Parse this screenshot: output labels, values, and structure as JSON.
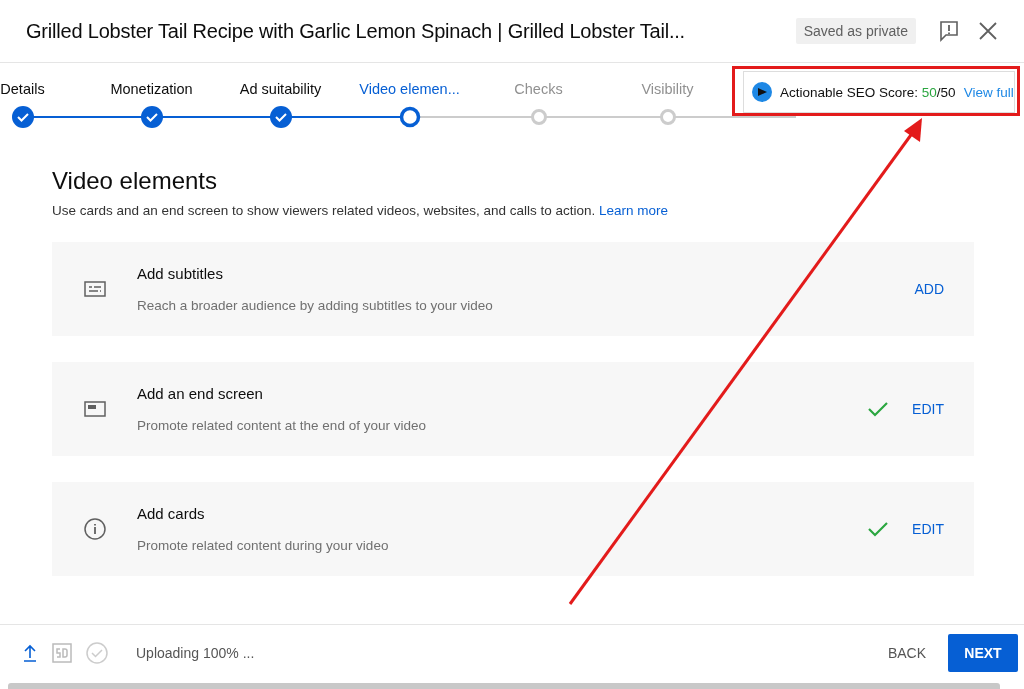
{
  "header": {
    "title": "Grilled Lobster Tail Recipe with Garlic Lemon Spinach | Grilled Lobster Tail...",
    "status_chip": "Saved as private"
  },
  "steps": [
    {
      "label": "Details",
      "completed": true,
      "selected": false
    },
    {
      "label": "Monetization",
      "completed": true,
      "selected": false
    },
    {
      "label": "Ad suitability",
      "completed": true,
      "selected": false
    },
    {
      "label": "Video elemen...",
      "completed": false,
      "selected": true
    },
    {
      "label": "Checks",
      "completed": false,
      "selected": false
    },
    {
      "label": "Visibility",
      "completed": false,
      "selected": false
    }
  ],
  "seo_widget": {
    "label": "Actionable SEO Score:",
    "score": "50",
    "total": "/50",
    "link": "View full"
  },
  "section": {
    "title": "Video elements",
    "description": "Use cards and an end screen to show viewers related videos, websites, and calls to action.",
    "link": "Learn more"
  },
  "elements": [
    {
      "kind": "subtitles",
      "title": "Add subtitles",
      "description": "Reach a broader audience by adding subtitles to your video",
      "done": false,
      "action": "ADD"
    },
    {
      "kind": "endscreen",
      "title": "Add an end screen",
      "description": "Promote related content at the end of your video",
      "done": true,
      "action": "EDIT"
    },
    {
      "kind": "cards",
      "title": "Add cards",
      "description": "Promote related content during your video",
      "done": true,
      "action": "EDIT"
    }
  ],
  "footer": {
    "status": "Uploading 100% ...",
    "back": "BACK",
    "next": "NEXT"
  }
}
